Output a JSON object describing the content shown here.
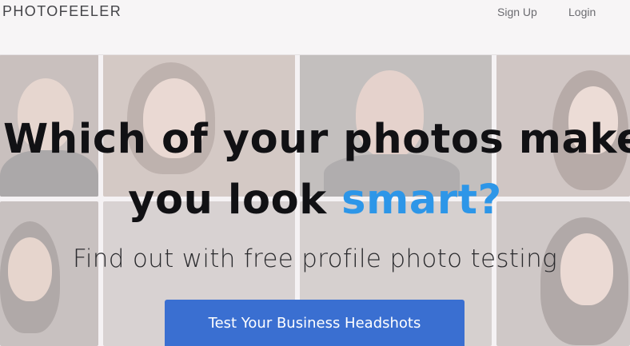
{
  "header": {
    "logo": "PHOTOFEELER",
    "nav": {
      "signup": "Sign Up",
      "login": "Login"
    }
  },
  "hero": {
    "headline_line1": "Which of your photos make",
    "headline_line2_prefix": "you look ",
    "headline_line2_accent": "smart?",
    "subhead": "Find out with free profile photo testing",
    "cta_label": "Test Your Business Headshots"
  },
  "colors": {
    "accent": "#2d96e8",
    "cta": "#3a6fd1",
    "headline": "#111114"
  }
}
